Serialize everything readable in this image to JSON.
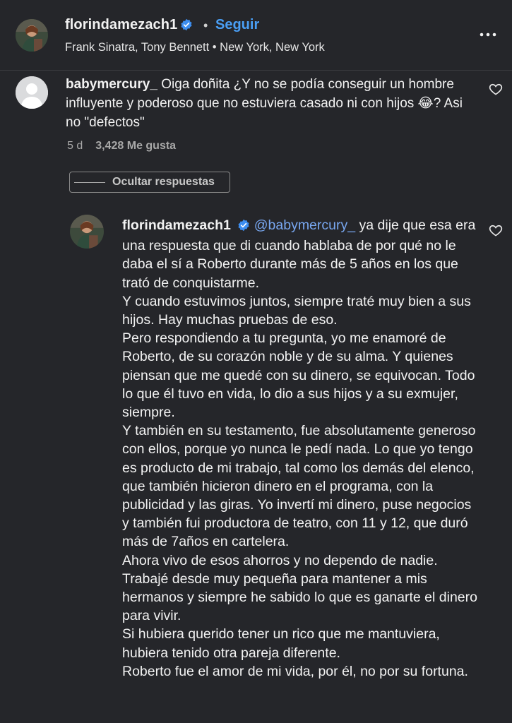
{
  "post_header": {
    "username": "florindamezach1",
    "follow_label": "Seguir",
    "subtitle": "Frank Sinatra, Tony Bennett • New York, New York",
    "separator": "•"
  },
  "comment": {
    "username": "babymercury_",
    "text": "Oiga doñita ¿Y no se podía conseguir un hombre influyente y poderoso que no estuviera casado ni con hijos 😂? Asi no \"defectos\"",
    "age": "5 d",
    "likes": "3,428 Me gusta"
  },
  "hide_replies_label": "Ocultar respuestas",
  "reply": {
    "username": "florindamezach1",
    "mention": "@babymercury_",
    "text": " ya dije que esa era una respuesta que di cuando hablaba de por qué no le daba el sí a Roberto durante más de 5 años en los que trató de conquistarme.\nY cuando estuvimos juntos, siempre traté muy bien a sus hijos. Hay muchas pruebas de eso.\nPero respondiendo a tu pregunta, yo me enamoré de Roberto, de su corazón noble y de su alma. Y quienes piensan que me quedé con su dinero, se equivocan. Todo lo que él tuvo en vida, lo dio a sus hijos y a su exmujer, siempre.\nY también en su testamento, fue absolutamente generoso con ellos, porque yo nunca le pedí nada. Lo que yo tengo es producto de mi trabajo, tal como los demás del elenco, que también hicieron dinero en el programa, con la publicidad y las giras. Yo invertí mi dinero, puse negocios y también fui productora de teatro, con 11 y 12, que duró más de 7años en cartelera.\nAhora vivo de esos ahorros y no dependo de nadie. Trabajé desde muy pequeña para mantener a mis hermanos y siempre he sabido lo que es ganarte el dinero para vivir.\nSi hubiera querido tener un rico que me mantuviera, hubiera tenido otra pareja diferente.\nRoberto fue el amor de mi vida, por él, no por su fortuna."
  },
  "colors": {
    "background": "#25262a",
    "text": "#f2f2f2",
    "link_blue": "#4a9ff5",
    "mention_blue": "#78a7f0",
    "muted": "#a8a8a8",
    "verified": "#3d8ef0"
  },
  "icons": [
    "verified-badge-icon",
    "more-options-icon",
    "heart-icon",
    "default-avatar-icon"
  ]
}
